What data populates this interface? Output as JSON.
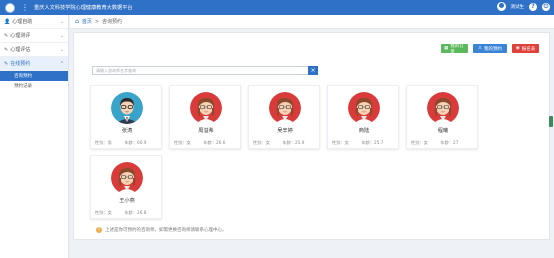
{
  "header": {
    "title": "重庆人文科技学院心理健康教育大数据平台",
    "username": "测试生",
    "help_icon": "?",
    "power_icon": "⏻"
  },
  "sidebar": {
    "items": [
      {
        "icon": "user-icon",
        "label": "心理自助"
      },
      {
        "icon": "edit-icon",
        "label": "心理测评"
      },
      {
        "icon": "edit-icon",
        "label": "心理评估"
      },
      {
        "icon": "edit-icon",
        "label": "在线预约"
      }
    ],
    "sub_items": [
      {
        "label": "咨询预约"
      },
      {
        "label": "预约记录"
      }
    ]
  },
  "breadcrumb": {
    "home": "首页",
    "separator": ">",
    "current": "咨询预约"
  },
  "toolbar": {
    "btn1": "我的订单",
    "btn2": "我的预约",
    "btn3": "报名表"
  },
  "search": {
    "placeholder": "请输入咨询师名字查询",
    "button_icon": "×"
  },
  "counselors": [
    {
      "name": "张涛",
      "gender_label": "性别：",
      "gender": "男",
      "age_label": "年龄：",
      "age": "60.9",
      "avatar": "male"
    },
    {
      "name": "周溢希",
      "gender_label": "性别：",
      "gender": "女",
      "age_label": "年龄：",
      "age": "26.6",
      "avatar": "female"
    },
    {
      "name": "吴辛婷",
      "gender_label": "性别：",
      "gender": "女",
      "age_label": "年龄：",
      "age": "25.9",
      "avatar": "female"
    },
    {
      "name": "商陆",
      "gender_label": "性别：",
      "gender": "女",
      "age_label": "年龄：",
      "age": "25.7",
      "avatar": "female"
    },
    {
      "name": "程曦",
      "gender_label": "性别：",
      "gender": "女",
      "age_label": "年龄：",
      "age": "27",
      "avatar": "female"
    },
    {
      "name": "王小燕",
      "gender_label": "性别：",
      "gender": "女",
      "age_label": "年龄：",
      "age": "26.8",
      "avatar": "female"
    }
  ],
  "notice": "上述是你可预约的咨询师，如需更换咨询师请联系心理中心。",
  "colors": {
    "primary": "#2f71c6",
    "success": "#5cb85c",
    "danger": "#e0413a",
    "female_bg": "#d93b3b",
    "male_bg": "#3aa3c9"
  }
}
